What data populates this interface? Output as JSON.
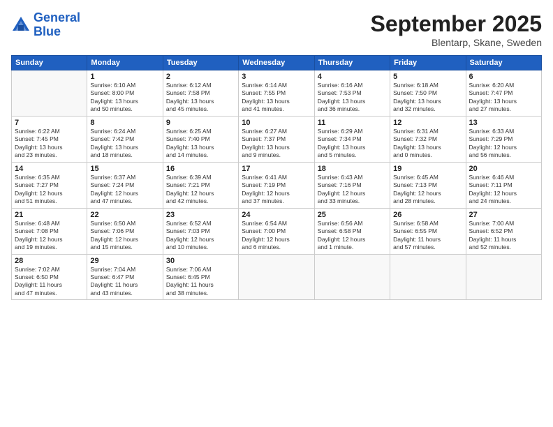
{
  "header": {
    "logo_line1": "General",
    "logo_line2": "Blue",
    "month": "September 2025",
    "location": "Blentarp, Skane, Sweden"
  },
  "days_of_week": [
    "Sunday",
    "Monday",
    "Tuesday",
    "Wednesday",
    "Thursday",
    "Friday",
    "Saturday"
  ],
  "weeks": [
    [
      {
        "day": "",
        "info": ""
      },
      {
        "day": "1",
        "info": "Sunrise: 6:10 AM\nSunset: 8:00 PM\nDaylight: 13 hours\nand 50 minutes."
      },
      {
        "day": "2",
        "info": "Sunrise: 6:12 AM\nSunset: 7:58 PM\nDaylight: 13 hours\nand 45 minutes."
      },
      {
        "day": "3",
        "info": "Sunrise: 6:14 AM\nSunset: 7:55 PM\nDaylight: 13 hours\nand 41 minutes."
      },
      {
        "day": "4",
        "info": "Sunrise: 6:16 AM\nSunset: 7:53 PM\nDaylight: 13 hours\nand 36 minutes."
      },
      {
        "day": "5",
        "info": "Sunrise: 6:18 AM\nSunset: 7:50 PM\nDaylight: 13 hours\nand 32 minutes."
      },
      {
        "day": "6",
        "info": "Sunrise: 6:20 AM\nSunset: 7:47 PM\nDaylight: 13 hours\nand 27 minutes."
      }
    ],
    [
      {
        "day": "7",
        "info": "Sunrise: 6:22 AM\nSunset: 7:45 PM\nDaylight: 13 hours\nand 23 minutes."
      },
      {
        "day": "8",
        "info": "Sunrise: 6:24 AM\nSunset: 7:42 PM\nDaylight: 13 hours\nand 18 minutes."
      },
      {
        "day": "9",
        "info": "Sunrise: 6:25 AM\nSunset: 7:40 PM\nDaylight: 13 hours\nand 14 minutes."
      },
      {
        "day": "10",
        "info": "Sunrise: 6:27 AM\nSunset: 7:37 PM\nDaylight: 13 hours\nand 9 minutes."
      },
      {
        "day": "11",
        "info": "Sunrise: 6:29 AM\nSunset: 7:34 PM\nDaylight: 13 hours\nand 5 minutes."
      },
      {
        "day": "12",
        "info": "Sunrise: 6:31 AM\nSunset: 7:32 PM\nDaylight: 13 hours\nand 0 minutes."
      },
      {
        "day": "13",
        "info": "Sunrise: 6:33 AM\nSunset: 7:29 PM\nDaylight: 12 hours\nand 56 minutes."
      }
    ],
    [
      {
        "day": "14",
        "info": "Sunrise: 6:35 AM\nSunset: 7:27 PM\nDaylight: 12 hours\nand 51 minutes."
      },
      {
        "day": "15",
        "info": "Sunrise: 6:37 AM\nSunset: 7:24 PM\nDaylight: 12 hours\nand 47 minutes."
      },
      {
        "day": "16",
        "info": "Sunrise: 6:39 AM\nSunset: 7:21 PM\nDaylight: 12 hours\nand 42 minutes."
      },
      {
        "day": "17",
        "info": "Sunrise: 6:41 AM\nSunset: 7:19 PM\nDaylight: 12 hours\nand 37 minutes."
      },
      {
        "day": "18",
        "info": "Sunrise: 6:43 AM\nSunset: 7:16 PM\nDaylight: 12 hours\nand 33 minutes."
      },
      {
        "day": "19",
        "info": "Sunrise: 6:45 AM\nSunset: 7:13 PM\nDaylight: 12 hours\nand 28 minutes."
      },
      {
        "day": "20",
        "info": "Sunrise: 6:46 AM\nSunset: 7:11 PM\nDaylight: 12 hours\nand 24 minutes."
      }
    ],
    [
      {
        "day": "21",
        "info": "Sunrise: 6:48 AM\nSunset: 7:08 PM\nDaylight: 12 hours\nand 19 minutes."
      },
      {
        "day": "22",
        "info": "Sunrise: 6:50 AM\nSunset: 7:06 PM\nDaylight: 12 hours\nand 15 minutes."
      },
      {
        "day": "23",
        "info": "Sunrise: 6:52 AM\nSunset: 7:03 PM\nDaylight: 12 hours\nand 10 minutes."
      },
      {
        "day": "24",
        "info": "Sunrise: 6:54 AM\nSunset: 7:00 PM\nDaylight: 12 hours\nand 6 minutes."
      },
      {
        "day": "25",
        "info": "Sunrise: 6:56 AM\nSunset: 6:58 PM\nDaylight: 12 hours\nand 1 minute."
      },
      {
        "day": "26",
        "info": "Sunrise: 6:58 AM\nSunset: 6:55 PM\nDaylight: 11 hours\nand 57 minutes."
      },
      {
        "day": "27",
        "info": "Sunrise: 7:00 AM\nSunset: 6:52 PM\nDaylight: 11 hours\nand 52 minutes."
      }
    ],
    [
      {
        "day": "28",
        "info": "Sunrise: 7:02 AM\nSunset: 6:50 PM\nDaylight: 11 hours\nand 47 minutes."
      },
      {
        "day": "29",
        "info": "Sunrise: 7:04 AM\nSunset: 6:47 PM\nDaylight: 11 hours\nand 43 minutes."
      },
      {
        "day": "30",
        "info": "Sunrise: 7:06 AM\nSunset: 6:45 PM\nDaylight: 11 hours\nand 38 minutes."
      },
      {
        "day": "",
        "info": ""
      },
      {
        "day": "",
        "info": ""
      },
      {
        "day": "",
        "info": ""
      },
      {
        "day": "",
        "info": ""
      }
    ]
  ]
}
